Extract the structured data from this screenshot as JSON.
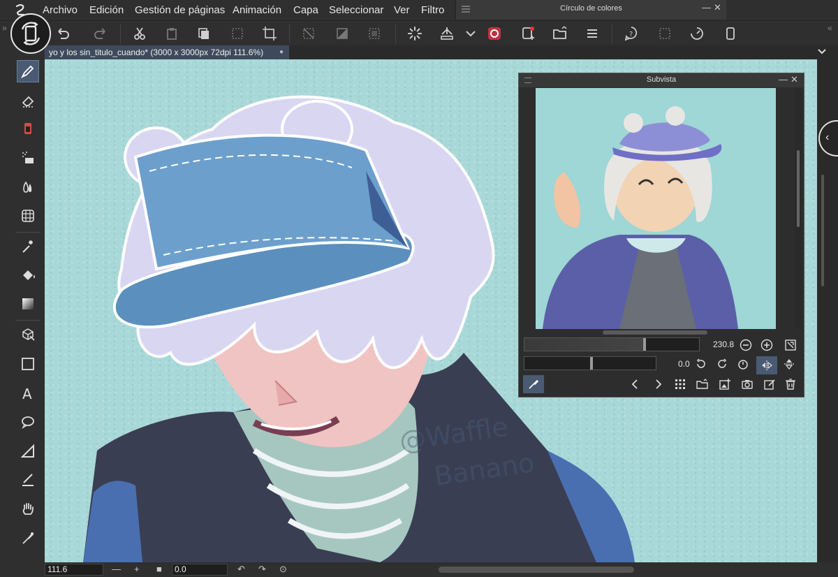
{
  "menu": {
    "items": [
      "Archivo",
      "Edición",
      "Gestión de páginas",
      "Animación",
      "Capa",
      "Seleccionar",
      "Ver",
      "Filtro"
    ],
    "floating_panel_title": "Círculo de colores"
  },
  "toolbar": {
    "icons": [
      "rotate-canvas-icon",
      "undo-icon",
      "redo-icon",
      "cut-icon",
      "paste-icon",
      "copy-icon",
      "clear-icon",
      "transform-icon",
      "deselect-icon",
      "invert-selection-icon",
      "show-selection-icon",
      "loading-icon",
      "fill-icon",
      "dropdown-icon",
      "clip-studio-icon",
      "new-document-icon",
      "open-icon",
      "menu-icon",
      "help-icon",
      "selection-icon",
      "timelapse-icon",
      "device-icon"
    ]
  },
  "document": {
    "tab_title": "yo y los sin_titulo_cuando* (3000 x 3000px 72dpi 111.6%)"
  },
  "tools": [
    "pen-tool-icon",
    "eraser-icon",
    "brush-icon",
    "airbrush-icon",
    "blend-icon",
    "grid-icon",
    "magic-wand-icon",
    "fill-bucket-icon",
    "gradient-icon",
    "3d-object-icon",
    "rectangle-icon",
    "text-icon",
    "balloon-icon",
    "ruler-icon",
    "correct-line-icon",
    "hand-icon",
    "eyedropper-icon"
  ],
  "subview": {
    "title": "Subvista",
    "zoom_value": "230.8",
    "rotation_value": "0.0"
  },
  "statusbar": {
    "zoom": "111.6",
    "rotation": "0.0"
  },
  "artwork": {
    "watermark_line1": "@Waffle",
    "watermark_line2": "Banano",
    "colors": {
      "background": "#a9d8d8",
      "hair": "#d9d6f2",
      "cap": "#5b8fbd",
      "skin": "#f0c4c2",
      "jacket": "#3a3e52",
      "sleeve": "#4a6fb0"
    }
  }
}
